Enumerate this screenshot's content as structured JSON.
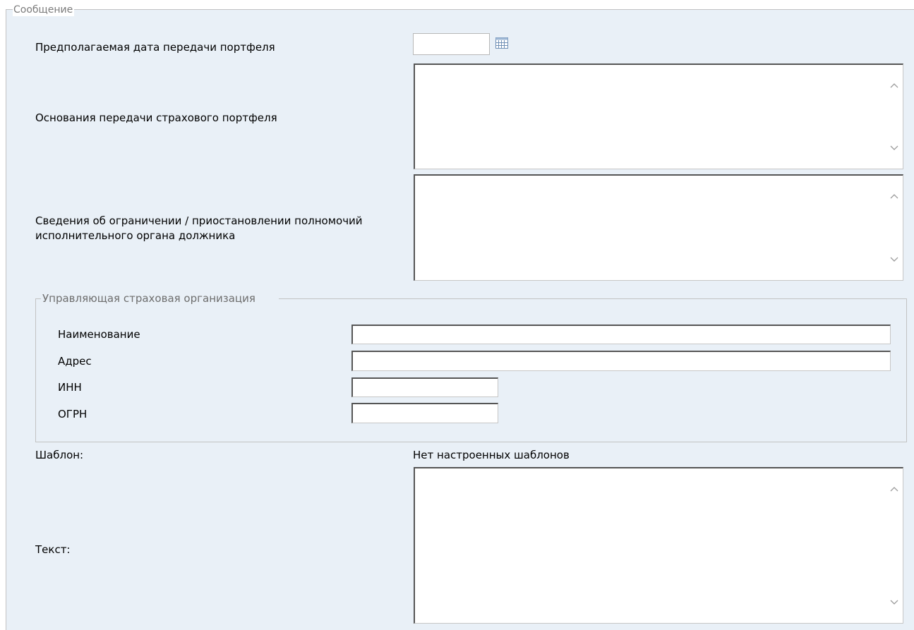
{
  "message_group": {
    "legend": "Сообщение",
    "transfer_date": {
      "label": "Предполагаемая дата передачи портфеля",
      "value": ""
    },
    "transfer_grounds": {
      "label": "Основания передачи страхового портфеля",
      "value": ""
    },
    "restriction_info": {
      "label_line1": "Сведения об ограничении / приостановлении полномочий",
      "label_line2": "исполнительного органа должника",
      "value": ""
    },
    "managing_org": {
      "legend": "Управляющая страховая организация",
      "name": {
        "label": "Наименование",
        "value": ""
      },
      "address": {
        "label": "Адрес",
        "value": ""
      },
      "inn": {
        "label": "ИНН",
        "value": ""
      },
      "ogrn": {
        "label": "ОГРН",
        "value": ""
      }
    },
    "template": {
      "label": "Шаблон:",
      "value": "Нет настроенных шаблонов"
    },
    "text": {
      "label": "Текст:",
      "value": ""
    }
  },
  "icons": {
    "calendar": "calendar-icon",
    "scroll_up": "chevron-up-icon",
    "scroll_down": "chevron-down-icon"
  },
  "colors": {
    "panel_background": "#e9f0f7",
    "border": "#c2c2c2",
    "legend_text": "#7b7b7b"
  }
}
